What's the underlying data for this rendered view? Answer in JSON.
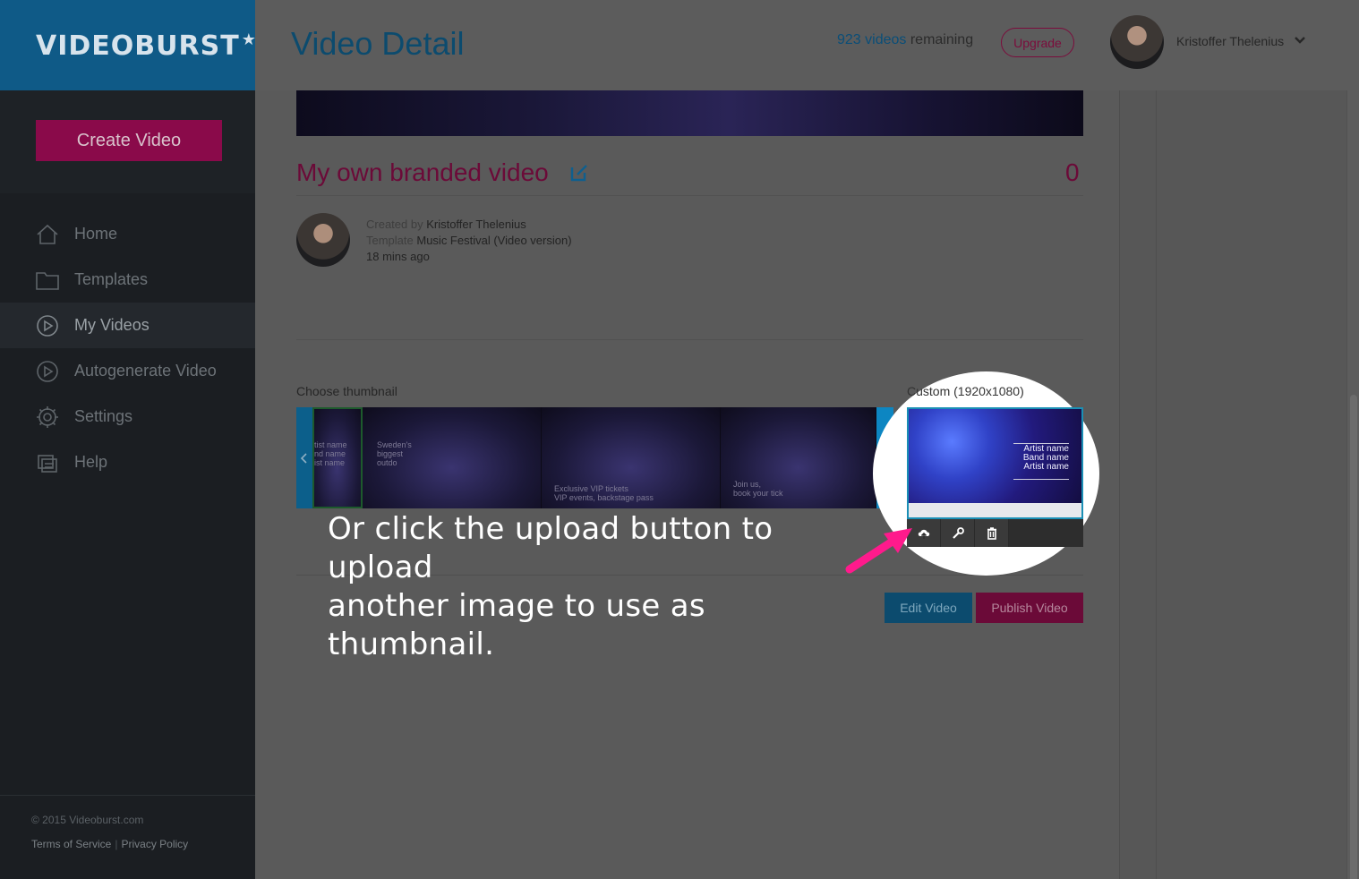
{
  "app": {
    "logo": "VIDEOBURST",
    "logo_star": "★"
  },
  "sidebar": {
    "create_label": "Create Video",
    "items": [
      {
        "label": "Home",
        "icon": "home-icon"
      },
      {
        "label": "Templates",
        "icon": "folder-icon"
      },
      {
        "label": "My Videos",
        "icon": "play-icon",
        "active": true
      },
      {
        "label": "Autogenerate Video",
        "icon": "play-circle-icon"
      },
      {
        "label": "Settings",
        "icon": "gear-icon"
      },
      {
        "label": "Help",
        "icon": "help-icon"
      }
    ],
    "copyright": "© 2015 Videoburst.com",
    "terms": "Terms of Service",
    "privacy": "Privacy Policy"
  },
  "header": {
    "title": "Video Detail",
    "remaining_count": "923 videos",
    "remaining_suffix": " remaining",
    "upgrade_label": "Upgrade",
    "user_name": "Kristoffer Thelenius"
  },
  "video": {
    "title": "My own branded video",
    "views": "0",
    "created_by_label": "Created by ",
    "created_by": "Kristoffer Thelenius",
    "template_label": "Template ",
    "template": "Music Festival (Video version)",
    "time_ago": "18 mins ago"
  },
  "thumbnails": {
    "choose_label": "Choose thumbnail",
    "custom_label": "Custom (1920x1080)",
    "frames": [
      {
        "text": "tist name\nnd name\nist name"
      },
      {
        "text": "Sweden's\nbiggest\noutdo"
      },
      {
        "text": "Exclusive VIP tickets\nVIP events, backstage pass"
      },
      {
        "text": "Join us,\nbook your tick"
      }
    ],
    "custom_text": "Artist name\nBand name\nArtist name"
  },
  "actions": {
    "edit_label": "Edit Video",
    "publish_label": "Publish Video"
  },
  "annotation": {
    "line1": "Or click the upload button to upload",
    "line2": "another image to use as thumbnail."
  },
  "colors": {
    "brand_blue": "#0c4b6e",
    "brand_magenta": "#6b0a38",
    "arrow_pink": "#ff1a8c"
  }
}
